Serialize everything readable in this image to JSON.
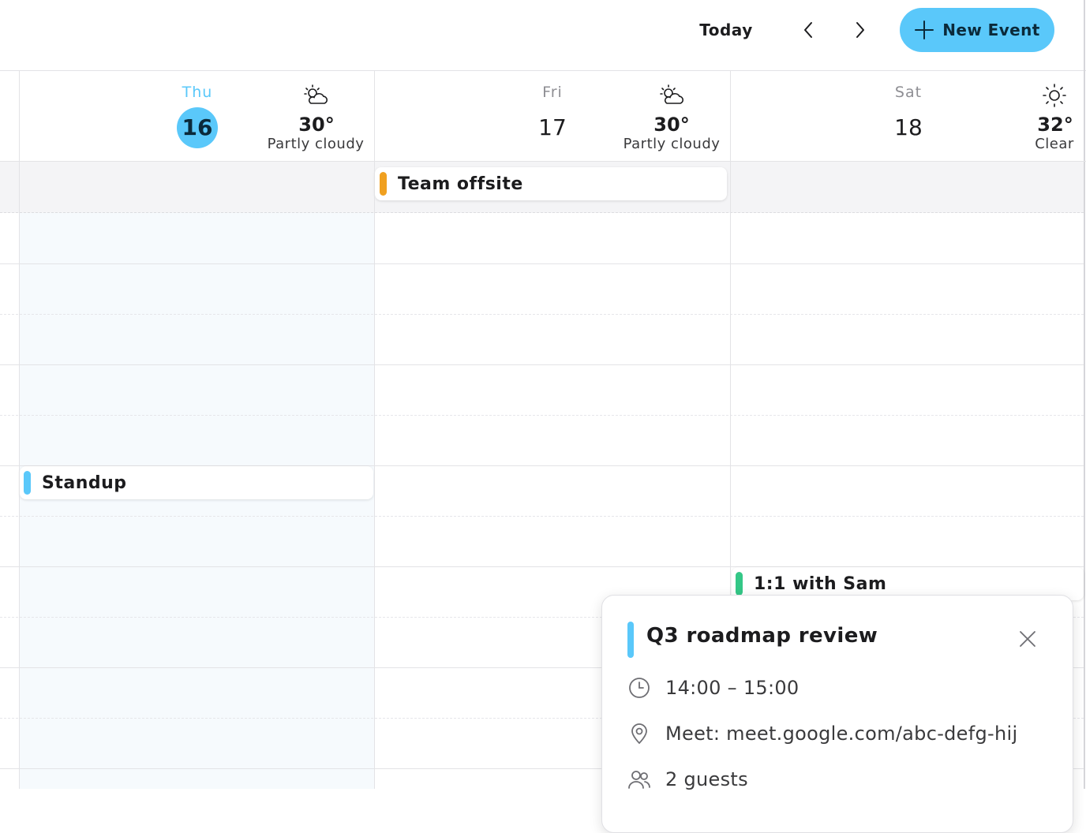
{
  "toolbar": {
    "today_label": "Today",
    "new_event_label": "New Event",
    "accent": "#5ac8fa"
  },
  "days": [
    {
      "dow": "Thu",
      "date": "16",
      "temp": "30°",
      "condition": "Partly cloudy",
      "icon": "partly-cloudy-icon",
      "is_today": true
    },
    {
      "dow": "Fri",
      "date": "17",
      "temp": "30°",
      "condition": "Partly cloudy",
      "icon": "partly-cloudy-icon",
      "is_today": false
    },
    {
      "dow": "Sat",
      "date": "18",
      "temp": "32°",
      "condition": "Clear",
      "icon": "sun-icon",
      "is_today": false
    }
  ],
  "all_day_events": [
    {
      "title": "Team offsite",
      "color": "#f0a020",
      "day": "Fri"
    }
  ],
  "events": [
    {
      "title": "Standup",
      "color": "#5ac8fa",
      "day": "Thu"
    },
    {
      "title": "1:1 with Sam",
      "color": "#34c787",
      "day": "Sat"
    }
  ],
  "popover": {
    "title": "Q3 roadmap review",
    "color": "#5ac8fa",
    "time": "14:00 – 15:00",
    "location": "Meet: meet.google.com/abc-defg-hij",
    "guests": "2 guests"
  }
}
